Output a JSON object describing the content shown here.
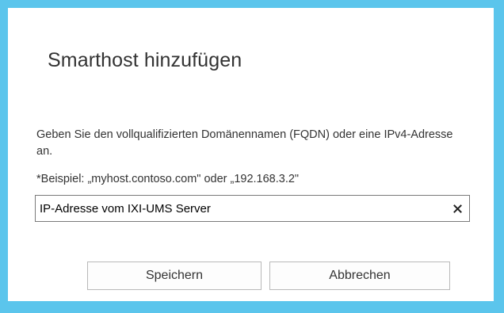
{
  "dialog": {
    "title": "Smarthost hinzufügen",
    "description": "Geben Sie den vollqualifizierten Domänennamen (FQDN) oder eine IPv4-Adresse an.",
    "example": "*Beispiel: „myhost.contoso.com\" oder „192.168.3.2\"",
    "input": {
      "value": "IP-Adresse vom IXI-UMS Server",
      "clear_icon": "close-icon"
    },
    "buttons": {
      "save_label": "Speichern",
      "cancel_label": "Abbrechen"
    }
  },
  "colors": {
    "frame": "#5bc5ec",
    "background": "#ffffff",
    "text": "#333333",
    "button_border": "#b9b9b9"
  }
}
